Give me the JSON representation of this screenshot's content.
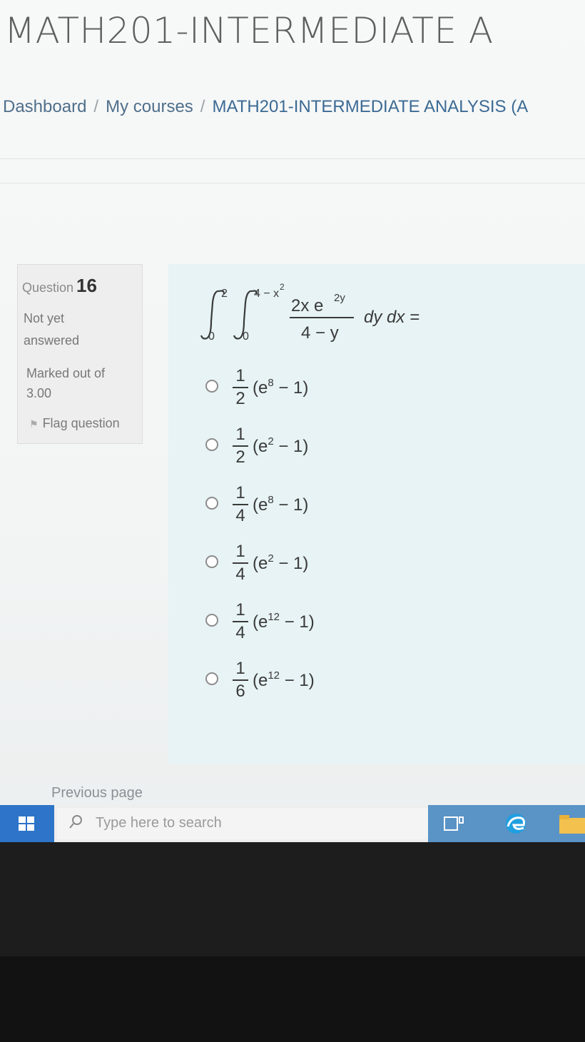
{
  "page": {
    "course_title": "MATH201-INTERMEDIATE A"
  },
  "breadcrumb": {
    "items": [
      "Dashboard",
      "My courses",
      "MATH201-INTERMEDIATE ANALYSIS (A"
    ],
    "separator": "/"
  },
  "question_info": {
    "label": "Question",
    "number": "16",
    "state": "Not yet answered",
    "marked_out_of": "Marked out of 3.00",
    "flag_label": "Flag question"
  },
  "question": {
    "integral": {
      "outer_upper": "2",
      "outer_lower": "0",
      "inner_upper": "4 − x",
      "inner_upper_exp": "2",
      "inner_lower": "0",
      "numerator": "2x e",
      "numerator_exp": "2y",
      "denominator": "4 − y",
      "tail": "dy dx ="
    },
    "options": [
      {
        "num": "1",
        "den": "2",
        "text": "(e",
        "exp": "8",
        "rest": " − 1)"
      },
      {
        "num": "1",
        "den": "2",
        "text": "(e",
        "exp": "2",
        "rest": " − 1)"
      },
      {
        "num": "1",
        "den": "4",
        "text": "(e",
        "exp": "8",
        "rest": " − 1)"
      },
      {
        "num": "1",
        "den": "4",
        "text": "(e",
        "exp": "2",
        "rest": " − 1)"
      },
      {
        "num": "1",
        "den": "4",
        "text": "(e",
        "exp": "12",
        "rest": " − 1)"
      },
      {
        "num": "1",
        "den": "6",
        "text": "(e",
        "exp": "12",
        "rest": " − 1)"
      }
    ]
  },
  "navigation": {
    "previous_page": "Previous page"
  },
  "taskbar": {
    "search_placeholder": "Type here to search",
    "icons": [
      "windows-start-icon",
      "search-icon",
      "task-view-icon",
      "edge-icon",
      "file-explorer-icon"
    ]
  },
  "colors": {
    "question_bg": "#e7f3f5",
    "info_bg": "#eeeeee",
    "breadcrumb_link": "#3c6a94",
    "taskbar_start": "#2e74c8"
  }
}
